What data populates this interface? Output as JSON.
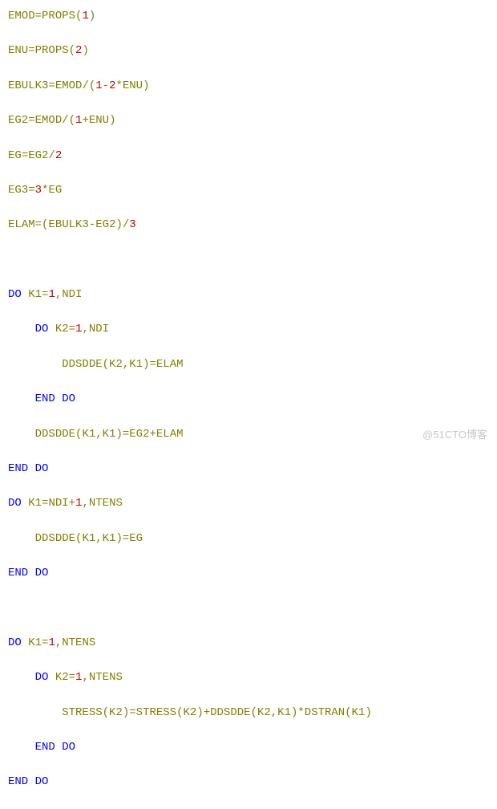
{
  "code": {
    "l1": {
      "v1": "EMOD",
      "op1": "=",
      "v2": "PROPS",
      "p1": "(",
      "n1": "1",
      "p2": ")"
    },
    "l2": {
      "v1": "ENU",
      "op1": "=",
      "v2": "PROPS",
      "p1": "(",
      "n1": "2",
      "p2": ")"
    },
    "l3": {
      "v1": "EBULK3",
      "op1": "=",
      "v2": "EMOD",
      "op2": "/",
      "p1": "(",
      "n1": "1",
      "op3": "-",
      "n2": "2",
      "op4": "*",
      "v3": "ENU",
      "p2": ")"
    },
    "l4": {
      "v1": "EG2",
      "op1": "=",
      "v2": "EMOD",
      "op2": "/",
      "p1": "(",
      "n1": "1",
      "op3": "+",
      "v3": "ENU",
      "p2": ")"
    },
    "l5": {
      "v1": "EG",
      "op1": "=",
      "v2": "EG2",
      "op2": "/",
      "n1": "2"
    },
    "l6": {
      "v1": "EG3",
      "op1": "=",
      "n1": "3",
      "op2": "*",
      "v2": "EG"
    },
    "l7": {
      "v1": "ELAM",
      "op1": "=",
      "p1": "(",
      "v2": "EBULK3",
      "op2": "-",
      "v3": "EG2",
      "p2": ")",
      "op3": "/",
      "n1": "3"
    },
    "l8": {
      "kw1": "DO",
      "sp1": " ",
      "v1": "K1",
      "op1": "=",
      "n1": "1",
      "c1": ",",
      "v2": "NDI"
    },
    "l9": {
      "kw1": "DO",
      "sp1": " ",
      "v1": "K2",
      "op1": "=",
      "n1": "1",
      "c1": ",",
      "v2": "NDI"
    },
    "l10": {
      "v1": "DDSDDE",
      "p1": "(",
      "v2": "K2",
      "c1": ",",
      "v3": "K1",
      "p2": ")",
      "op1": "=",
      "v4": "ELAM"
    },
    "l11": {
      "kw1": "END",
      "sp1": " ",
      "kw2": "DO"
    },
    "l12": {
      "v1": "DDSDDE",
      "p1": "(",
      "v2": "K1",
      "c1": ",",
      "v3": "K1",
      "p2": ")",
      "op1": "=",
      "v4": "EG2",
      "op2": "+",
      "v5": "ELAM"
    },
    "l13": {
      "kw1": "END",
      "sp1": " ",
      "kw2": "DO"
    },
    "l14": {
      "kw1": "DO",
      "sp1": " ",
      "v1": "K1",
      "op1": "=",
      "v2": "NDI",
      "op2": "+",
      "n1": "1",
      "c1": ",",
      "v3": "NTENS"
    },
    "l15": {
      "v1": "DDSDDE",
      "p1": "(",
      "v2": "K1",
      "c1": ",",
      "v3": "K1",
      "p2": ")",
      "op1": "=",
      "v4": "EG"
    },
    "l16": {
      "kw1": "END",
      "sp1": " ",
      "kw2": "DO"
    },
    "l17": {
      "kw1": "DO",
      "sp1": " ",
      "v1": "K1",
      "op1": "=",
      "n1": "1",
      "c1": ",",
      "v2": "NTENS"
    },
    "l18": {
      "kw1": "DO",
      "sp1": " ",
      "v1": "K2",
      "op1": "=",
      "n1": "1",
      "c1": ",",
      "v2": "NTENS"
    },
    "l19": {
      "v1": "STRESS",
      "p1": "(",
      "v2": "K2",
      "p2": ")",
      "op1": "=",
      "v3": "STRESS",
      "p3": "(",
      "v4": "K2",
      "p4": ")",
      "op2": "+",
      "v5": "DDSDDE",
      "p5": "(",
      "v6": "K2",
      "c1": ",",
      "v7": "K1",
      "p6": ")",
      "op3": "*",
      "v8": "DSTRAN",
      "p7": "(",
      "v9": "K1",
      "p8": ")"
    },
    "l20": {
      "kw1": "END",
      "sp1": " ",
      "kw2": "DO"
    },
    "l21": {
      "kw1": "END",
      "sp1": " ",
      "kw2": "DO"
    }
  },
  "watermark": "@51CTO博客"
}
